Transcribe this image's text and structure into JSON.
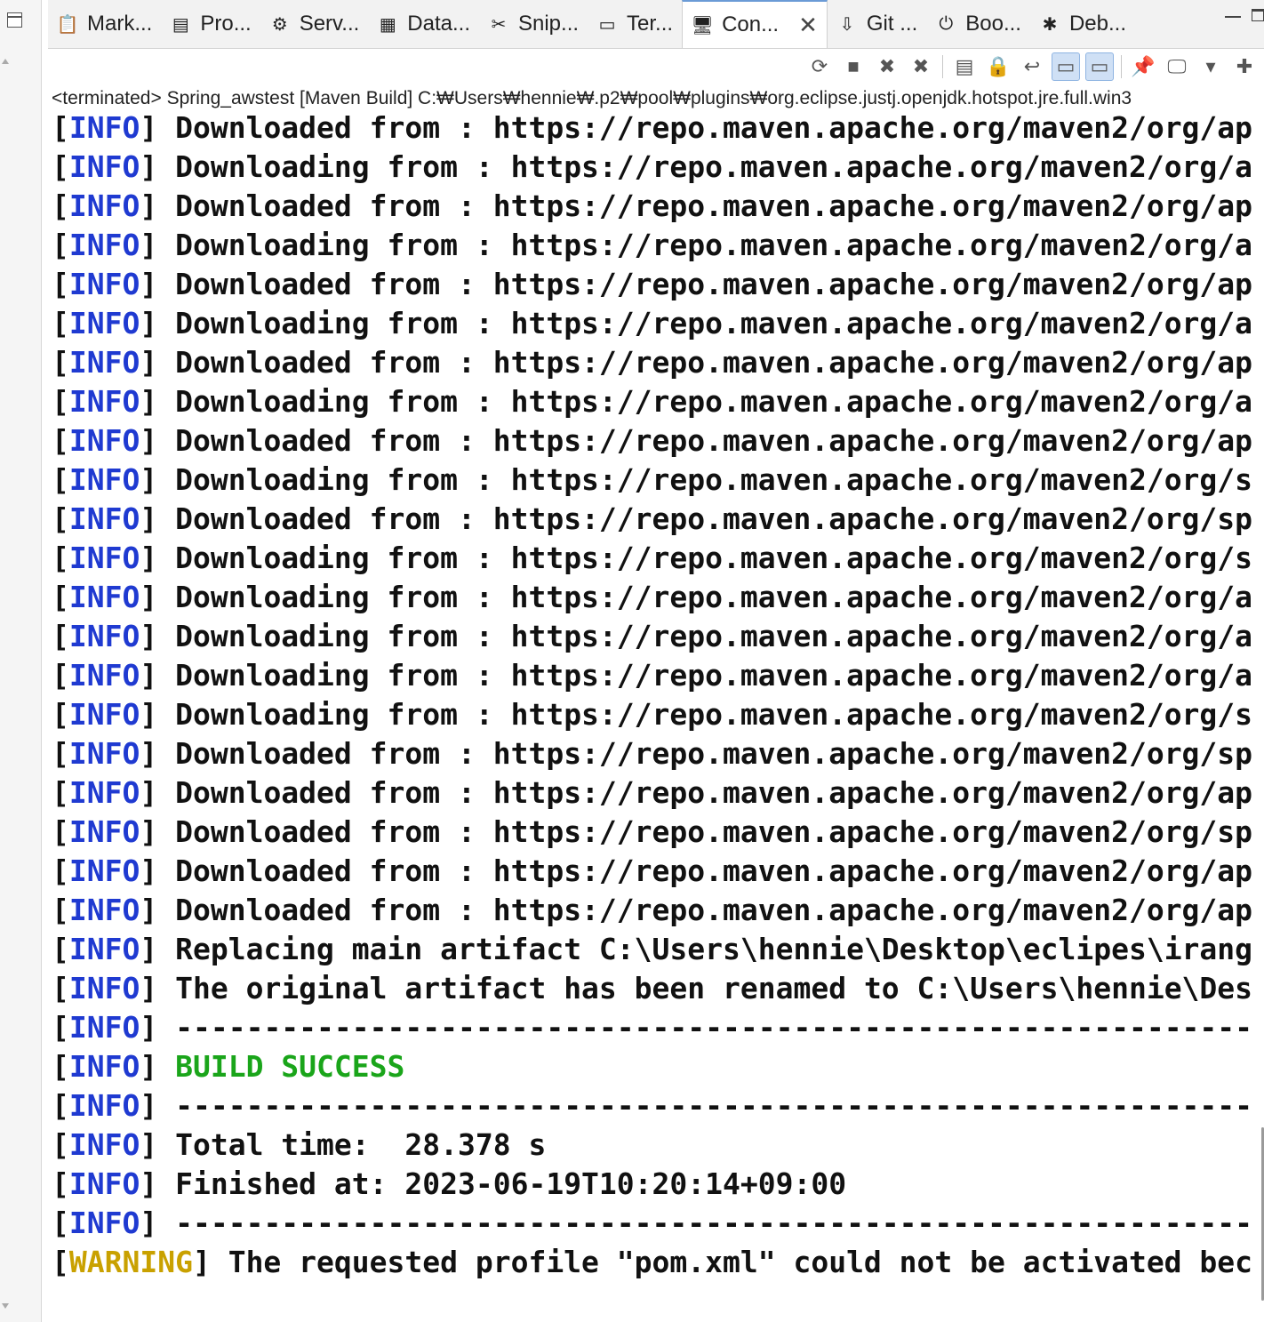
{
  "tabs": [
    {
      "label": "Mark...",
      "icon": "markers-icon",
      "glyph": "📋",
      "active": false
    },
    {
      "label": "Pro...",
      "icon": "properties-icon",
      "glyph": "▤",
      "active": false
    },
    {
      "label": "Serv...",
      "icon": "servers-icon",
      "glyph": "⚙",
      "active": false
    },
    {
      "label": "Data...",
      "icon": "data-source-explorer-icon",
      "glyph": "▦",
      "active": false
    },
    {
      "label": "Snip...",
      "icon": "snippets-icon",
      "glyph": "✂",
      "active": false
    },
    {
      "label": "Ter...",
      "icon": "terminal-icon",
      "glyph": "▭",
      "active": false
    },
    {
      "label": "Con...",
      "icon": "console-icon",
      "glyph": "🖥",
      "active": true
    },
    {
      "label": "Git ...",
      "icon": "git-staging-icon",
      "glyph": "⇩",
      "active": false
    },
    {
      "label": "Boo...",
      "icon": "boot-dashboard-icon",
      "glyph": "⏻",
      "active": false
    },
    {
      "label": "Deb...",
      "icon": "debug-icon",
      "glyph": "✱",
      "active": false
    }
  ],
  "toolbar": [
    {
      "name": "sync-icon",
      "glyph": "⟳",
      "pressed": false
    },
    {
      "name": "terminate-icon",
      "glyph": "■",
      "pressed": false
    },
    {
      "name": "remove-launch-icon",
      "glyph": "✖",
      "pressed": false
    },
    {
      "name": "remove-all-terminated-icon",
      "glyph": "✖",
      "pressed": false
    },
    {
      "sep": true
    },
    {
      "name": "clear-console-icon",
      "glyph": "▤",
      "pressed": false
    },
    {
      "name": "scroll-lock-icon",
      "glyph": "🔒",
      "pressed": false
    },
    {
      "name": "word-wrap-icon",
      "glyph": "↩",
      "pressed": false
    },
    {
      "name": "show-on-stdout-icon",
      "glyph": "▭",
      "pressed": true
    },
    {
      "name": "show-on-stderr-icon",
      "glyph": "▭",
      "pressed": true
    },
    {
      "sep": true
    },
    {
      "name": "pin-console-icon",
      "glyph": "📌",
      "pressed": false
    },
    {
      "name": "display-selected-console-icon",
      "glyph": "🖵",
      "pressed": false
    },
    {
      "name": "chevron-down-icon",
      "glyph": "▾",
      "pressed": false
    },
    {
      "name": "open-console-icon",
      "glyph": "✚",
      "pressed": false
    }
  ],
  "status_line": "<terminated> Spring_awstest [Maven Build] C:₩Users₩hennie₩.p2₩pool₩plugins₩org.eclipse.justj.openjdk.hotspot.jre.full.win3",
  "console_lines": [
    {
      "tag": "INFO",
      "type": "info",
      "text": " Downloaded from : https://repo.maven.apache.org/maven2/org/ap"
    },
    {
      "tag": "INFO",
      "type": "info",
      "text": " Downloading from : https://repo.maven.apache.org/maven2/org/a"
    },
    {
      "tag": "INFO",
      "type": "info",
      "text": " Downloaded from : https://repo.maven.apache.org/maven2/org/ap"
    },
    {
      "tag": "INFO",
      "type": "info",
      "text": " Downloading from : https://repo.maven.apache.org/maven2/org/a"
    },
    {
      "tag": "INFO",
      "type": "info",
      "text": " Downloaded from : https://repo.maven.apache.org/maven2/org/ap"
    },
    {
      "tag": "INFO",
      "type": "info",
      "text": " Downloading from : https://repo.maven.apache.org/maven2/org/a"
    },
    {
      "tag": "INFO",
      "type": "info",
      "text": " Downloaded from : https://repo.maven.apache.org/maven2/org/ap"
    },
    {
      "tag": "INFO",
      "type": "info",
      "text": " Downloading from : https://repo.maven.apache.org/maven2/org/a"
    },
    {
      "tag": "INFO",
      "type": "info",
      "text": " Downloaded from : https://repo.maven.apache.org/maven2/org/ap"
    },
    {
      "tag": "INFO",
      "type": "info",
      "text": " Downloading from : https://repo.maven.apache.org/maven2/org/s"
    },
    {
      "tag": "INFO",
      "type": "info",
      "text": " Downloaded from : https://repo.maven.apache.org/maven2/org/sp"
    },
    {
      "tag": "INFO",
      "type": "info",
      "text": " Downloading from : https://repo.maven.apache.org/maven2/org/s"
    },
    {
      "tag": "INFO",
      "type": "info",
      "text": " Downloading from : https://repo.maven.apache.org/maven2/org/a"
    },
    {
      "tag": "INFO",
      "type": "info",
      "text": " Downloading from : https://repo.maven.apache.org/maven2/org/a"
    },
    {
      "tag": "INFO",
      "type": "info",
      "text": " Downloading from : https://repo.maven.apache.org/maven2/org/a"
    },
    {
      "tag": "INFO",
      "type": "info",
      "text": " Downloading from : https://repo.maven.apache.org/maven2/org/s"
    },
    {
      "tag": "INFO",
      "type": "info",
      "text": " Downloaded from : https://repo.maven.apache.org/maven2/org/sp"
    },
    {
      "tag": "INFO",
      "type": "info",
      "text": " Downloaded from : https://repo.maven.apache.org/maven2/org/ap"
    },
    {
      "tag": "INFO",
      "type": "info",
      "text": " Downloaded from : https://repo.maven.apache.org/maven2/org/sp"
    },
    {
      "tag": "INFO",
      "type": "info",
      "text": " Downloaded from : https://repo.maven.apache.org/maven2/org/ap"
    },
    {
      "tag": "INFO",
      "type": "info",
      "text": " Downloaded from : https://repo.maven.apache.org/maven2/org/ap"
    },
    {
      "tag": "INFO",
      "type": "info",
      "text": " Replacing main artifact C:\\Users\\hennie\\Desktop\\eclipes\\irang"
    },
    {
      "tag": "INFO",
      "type": "info",
      "text": " The original artifact has been renamed to C:\\Users\\hennie\\Des"
    },
    {
      "tag": "INFO",
      "type": "info",
      "text": " ------------------------------------------------------------------------"
    },
    {
      "tag": "INFO",
      "type": "success",
      "text": " BUILD SUCCESS"
    },
    {
      "tag": "INFO",
      "type": "info",
      "text": " ------------------------------------------------------------------------"
    },
    {
      "tag": "INFO",
      "type": "info",
      "text": " Total time:  28.378 s"
    },
    {
      "tag": "INFO",
      "type": "info",
      "text": " Finished at: 2023-06-19T10:20:14+09:00"
    },
    {
      "tag": "INFO",
      "type": "info",
      "text": " ------------------------------------------------------------------------"
    },
    {
      "tag": "WARNING",
      "type": "warning",
      "text": " The requested profile \"pom.xml\" could not be activated bec"
    }
  ],
  "colors": {
    "info_tag": "#1f3ad1",
    "warning_tag": "#c9a100",
    "success": "#1aa51a",
    "active_tab_accent": "#6b9bd6"
  }
}
